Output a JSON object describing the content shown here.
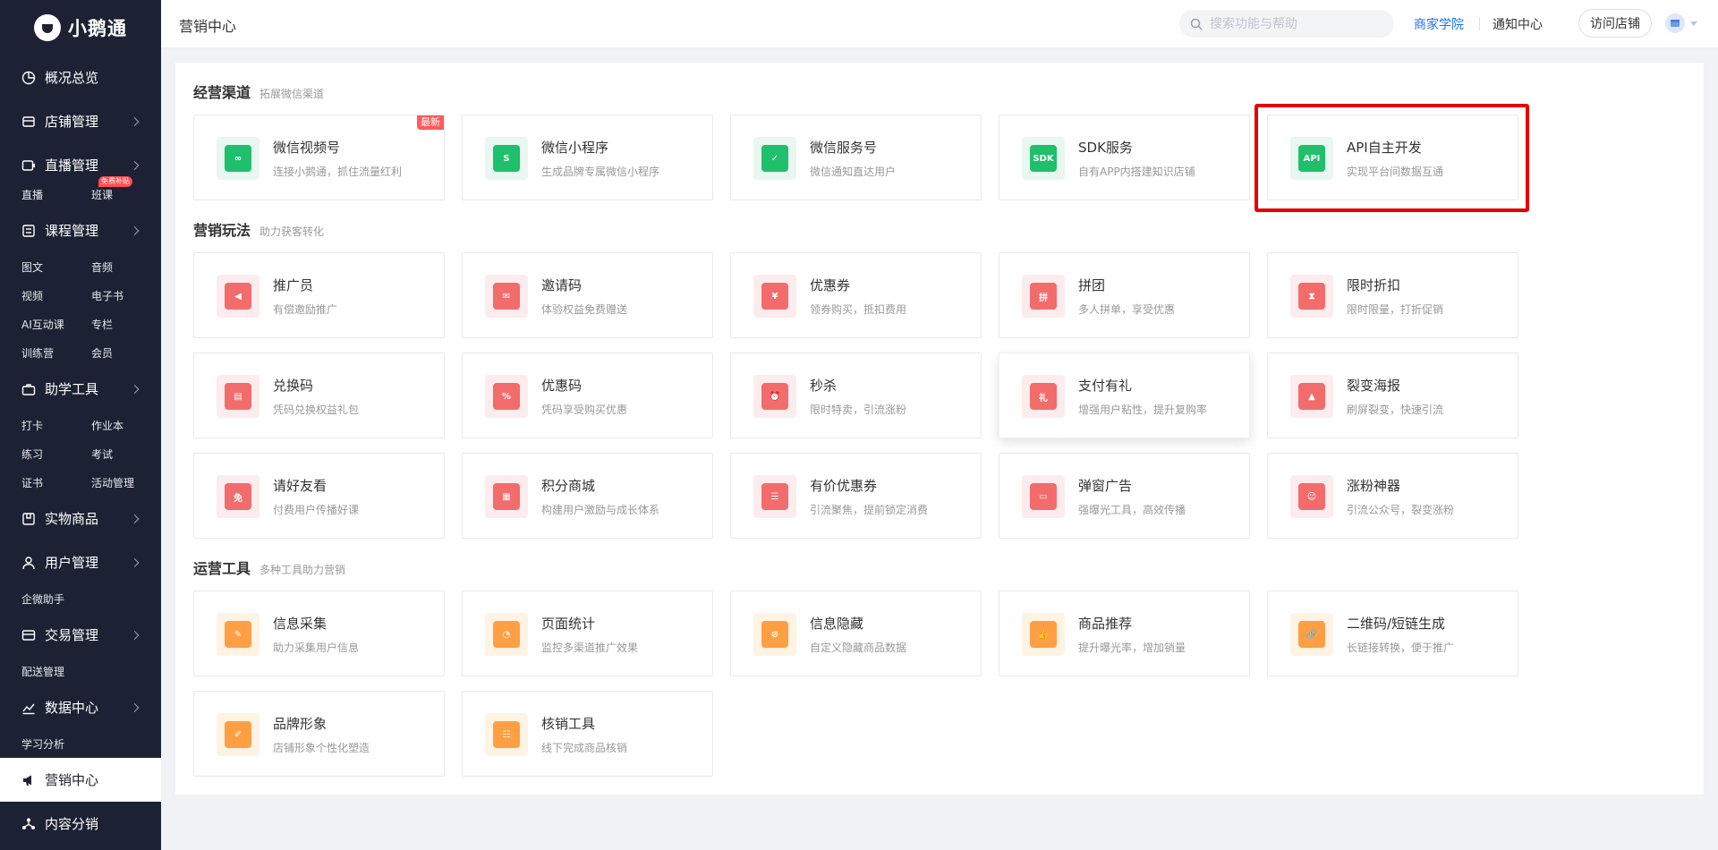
{
  "brand": {
    "name": "小鹅通"
  },
  "sidebar": {
    "menus": [
      {
        "label": "概况总览",
        "icon": "pie-chart-icon",
        "chevron": false,
        "active": false,
        "subs": []
      },
      {
        "label": "店铺管理",
        "icon": "store-icon",
        "chevron": true,
        "active": false,
        "subs": []
      },
      {
        "label": "直播管理",
        "icon": "live-tv-icon",
        "chevron": true,
        "active": false,
        "subs": [
          {
            "label": "直播"
          },
          {
            "label": "班课",
            "tag": "免费补贴"
          }
        ]
      },
      {
        "label": "课程管理",
        "icon": "course-list-icon",
        "chevron": true,
        "active": false,
        "subs": [
          {
            "label": "图文"
          },
          {
            "label": "音频"
          },
          {
            "label": "视频"
          },
          {
            "label": "电子书"
          },
          {
            "label": "AI互动课"
          },
          {
            "label": "专栏"
          },
          {
            "label": "训练营"
          },
          {
            "label": "会员"
          }
        ]
      },
      {
        "label": "助学工具",
        "icon": "toolbox-icon",
        "chevron": true,
        "active": false,
        "subs": [
          {
            "label": "打卡"
          },
          {
            "label": "作业本"
          },
          {
            "label": "练习"
          },
          {
            "label": "考试"
          },
          {
            "label": "证书"
          },
          {
            "label": "活动管理"
          }
        ]
      },
      {
        "label": "实物商品",
        "icon": "package-icon",
        "chevron": true,
        "active": false,
        "subs": []
      },
      {
        "label": "用户管理",
        "icon": "user-icon",
        "chevron": true,
        "active": false,
        "subs": [
          {
            "label": "企微助手"
          }
        ]
      },
      {
        "label": "交易管理",
        "icon": "wallet-icon",
        "chevron": true,
        "active": false,
        "subs": [
          {
            "label": "配送管理"
          }
        ]
      },
      {
        "label": "数据中心",
        "icon": "line-chart-icon",
        "chevron": true,
        "active": false,
        "subs": [
          {
            "label": "学习分析"
          }
        ]
      },
      {
        "label": "营销中心",
        "icon": "megaphone-icon",
        "chevron": false,
        "active": true,
        "subs": []
      },
      {
        "label": "内容分销",
        "icon": "share-icon",
        "chevron": false,
        "active": false,
        "subs": []
      }
    ]
  },
  "header": {
    "title": "营销中心",
    "search_placeholder": "搜索功能与帮助",
    "academy": "商家学院",
    "notice": "通知中心",
    "visit_store": "访问店铺"
  },
  "sections": [
    {
      "title": "经营渠道",
      "subtitle": "拓展微信渠道",
      "cards": [
        {
          "name": "微信视频号",
          "desc": "连接小鹅通，抓住流量红利",
          "color": "green",
          "glyph": "∞",
          "icon": "wechat-channels-icon",
          "badge": "最新"
        },
        {
          "name": "微信小程序",
          "desc": "生成品牌专属微信小程序",
          "color": "green",
          "glyph": "S",
          "icon": "mini-program-icon"
        },
        {
          "name": "微信服务号",
          "desc": "微信通知直达用户",
          "color": "green",
          "glyph": "✓",
          "icon": "service-account-icon"
        },
        {
          "name": "SDK服务",
          "desc": "自有APP内搭建知识店铺",
          "color": "green",
          "glyph": "SDK",
          "icon": "sdk-icon"
        },
        {
          "name": "API自主开发",
          "desc": "实现平台间数据互通",
          "color": "green",
          "glyph": "API",
          "icon": "api-icon"
        }
      ]
    },
    {
      "title": "营销玩法",
      "subtitle": "助力获客转化",
      "cards": [
        {
          "name": "推广员",
          "desc": "有偿邀励推广",
          "color": "red",
          "glyph": "◀",
          "icon": "megaphone-icon"
        },
        {
          "name": "邀请码",
          "desc": "体验权益免费赠送",
          "color": "red",
          "glyph": "✉",
          "icon": "invite-code-icon"
        },
        {
          "name": "优惠券",
          "desc": "领券购买，抵扣费用",
          "color": "red",
          "glyph": "¥",
          "icon": "coupon-icon"
        },
        {
          "name": "拼团",
          "desc": "多人拼单，享受优惠",
          "color": "red",
          "glyph": "拼",
          "icon": "group-buy-icon"
        },
        {
          "name": "限时折扣",
          "desc": "限时限量，打折促销",
          "color": "red",
          "glyph": "⧗",
          "icon": "hourglass-icon"
        },
        {
          "name": "兑换码",
          "desc": "凭码兑换权益礼包",
          "color": "red",
          "glyph": "▤",
          "icon": "redeem-code-icon"
        },
        {
          "name": "优惠码",
          "desc": "凭码享受购买优惠",
          "color": "red",
          "glyph": "%",
          "icon": "discount-code-icon"
        },
        {
          "name": "秒杀",
          "desc": "限时特卖，引流涨粉",
          "color": "red",
          "glyph": "⏰",
          "icon": "alarm-clock-icon"
        },
        {
          "name": "支付有礼",
          "desc": "增强用户粘性，提升复购率",
          "color": "red",
          "glyph": "礼",
          "icon": "gift-icon"
        },
        {
          "name": "裂变海报",
          "desc": "刷屏裂变，快速引流",
          "color": "red",
          "glyph": "▲",
          "icon": "poster-image-icon"
        },
        {
          "name": "请好友看",
          "desc": "付费用户传播好课",
          "color": "red",
          "glyph": "免",
          "icon": "free-gift-bag-icon"
        },
        {
          "name": "积分商城",
          "desc": "构建用户激励与成长体系",
          "color": "red",
          "glyph": "▦",
          "icon": "points-mall-icon"
        },
        {
          "name": "有价优惠券",
          "desc": "引流聚焦，提前锁定消费",
          "color": "red",
          "glyph": "☰",
          "icon": "paid-coupon-icon"
        },
        {
          "name": "弹窗广告",
          "desc": "强曝光工具，高效传播",
          "color": "red",
          "glyph": "▭",
          "icon": "popup-ad-icon"
        },
        {
          "name": "涨粉神器",
          "desc": "引流公众号，裂变涨粉",
          "color": "red",
          "glyph": "☺",
          "icon": "fans-growth-icon"
        }
      ]
    },
    {
      "title": "运营工具",
      "subtitle": "多种工具助力营销",
      "cards": [
        {
          "name": "信息采集",
          "desc": "助力采集用户信息",
          "color": "orange",
          "glyph": "✎",
          "icon": "form-collect-icon"
        },
        {
          "name": "页面统计",
          "desc": "监控多渠道推广效果",
          "color": "orange",
          "glyph": "◔",
          "icon": "pie-stats-icon"
        },
        {
          "name": "信息隐藏",
          "desc": "自定义隐藏商品数据",
          "color": "orange",
          "glyph": "⊘",
          "icon": "eye-hidden-icon"
        },
        {
          "name": "商品推荐",
          "desc": "提升曝光率，增加销量",
          "color": "orange",
          "glyph": "👍",
          "icon": "thumbs-up-icon"
        },
        {
          "name": "二维码/短链生成",
          "desc": "长链接转换，便于推广",
          "color": "orange",
          "glyph": "🔗",
          "icon": "link-icon"
        },
        {
          "name": "品牌形象",
          "desc": "店铺形象个性化塑造",
          "color": "orange",
          "glyph": "✐",
          "icon": "brand-image-icon"
        },
        {
          "name": "核销工具",
          "desc": "线下完成商品核销",
          "color": "orange",
          "glyph": "☷",
          "icon": "verify-tool-icon"
        }
      ]
    }
  ],
  "highlighted_card": "API自主开发",
  "hovered_card": "支付有礼",
  "colors": {
    "sidebar_bg": "#1c2233",
    "accent_blue": "#1e72f5",
    "green": "#1fbf6b",
    "red": "#f26c6c",
    "orange": "#ff9f43",
    "highlight": "#e60000"
  }
}
